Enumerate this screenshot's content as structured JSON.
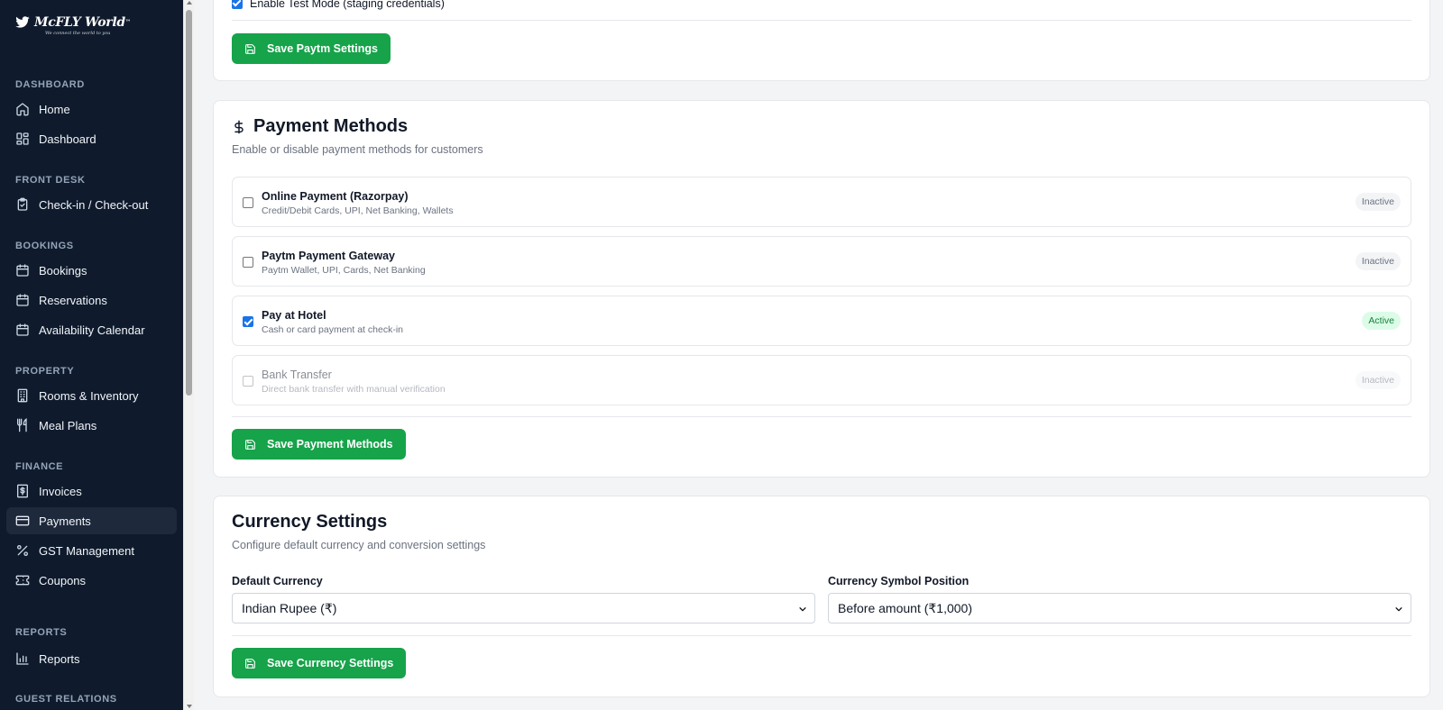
{
  "brand": {
    "name": "McFLY World",
    "tm": "™",
    "tagline": "We connect the world to you"
  },
  "sidebar": {
    "sections": [
      {
        "label": "DASHBOARD"
      },
      {
        "label": "FRONT DESK"
      },
      {
        "label": "BOOKINGS"
      },
      {
        "label": "PROPERTY"
      },
      {
        "label": "FINANCE"
      },
      {
        "label": "REPORTS"
      },
      {
        "label": "GUEST RELATIONS"
      }
    ],
    "items": [
      {
        "label": "Home",
        "icon": "home-icon"
      },
      {
        "label": "Dashboard",
        "icon": "dashboard-icon"
      },
      {
        "label": "Check-in / Check-out",
        "icon": "clipboard-check-icon"
      },
      {
        "label": "Bookings",
        "icon": "calendar-icon"
      },
      {
        "label": "Reservations",
        "icon": "calendar-icon"
      },
      {
        "label": "Availability Calendar",
        "icon": "calendar-icon"
      },
      {
        "label": "Rooms & Inventory",
        "icon": "building-icon"
      },
      {
        "label": "Meal Plans",
        "icon": "utensils-icon"
      },
      {
        "label": "Invoices",
        "icon": "receipt-icon"
      },
      {
        "label": "Payments",
        "icon": "credit-card-icon",
        "active": true
      },
      {
        "label": "GST Management",
        "icon": "percent-icon"
      },
      {
        "label": "Coupons",
        "icon": "ticket-icon"
      },
      {
        "label": "Reports",
        "icon": "bar-chart-icon"
      }
    ]
  },
  "paytm": {
    "test_mode_label": "Enable Test Mode (staging credentials)",
    "test_mode_checked": true,
    "save_label": "Save Paytm Settings"
  },
  "payment_methods": {
    "icon": "dollar-icon",
    "title": "Payment Methods",
    "subtitle": "Enable or disable payment methods for customers",
    "methods": [
      {
        "name": "Online Payment (Razorpay)",
        "description": "Credit/Debit Cards, UPI, Net Banking, Wallets",
        "status": "Inactive",
        "checked": false
      },
      {
        "name": "Paytm Payment Gateway",
        "description": "Paytm Wallet, UPI, Cards, Net Banking",
        "status": "Inactive",
        "checked": false
      },
      {
        "name": "Pay at Hotel",
        "description": "Cash or card payment at check-in",
        "status": "Active",
        "checked": true
      },
      {
        "name": "Bank Transfer",
        "description": "Direct bank transfer with manual verification",
        "status": "Inactive",
        "checked": false,
        "disabled": true
      }
    ],
    "save_label": "Save Payment Methods"
  },
  "currency": {
    "title": "Currency Settings",
    "subtitle": "Configure default currency and conversion settings",
    "default_currency_label": "Default Currency",
    "default_currency_value": "Indian Rupee (₹)",
    "symbol_position_label": "Currency Symbol Position",
    "symbol_position_value": "Before amount (₹1,000)",
    "save_label": "Save Currency Settings"
  },
  "colors": {
    "sidebar_bg": "#0f1b2d",
    "accent_green": "#16a34a",
    "active_badge": "#15803d"
  }
}
